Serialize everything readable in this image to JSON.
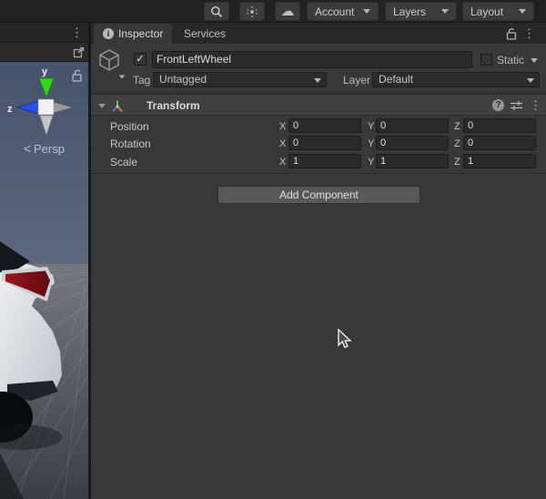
{
  "icons": {
    "cloud": "☁",
    "kebab": "⋮",
    "info": "i",
    "help": "?",
    "check": "✓"
  },
  "toolbar": {
    "account": "Account",
    "layers": "Layers",
    "layout": "Layout"
  },
  "scene": {
    "persp": "Persp",
    "persp_arrow": "<",
    "gizmo_y": "y",
    "gizmo_z": "z"
  },
  "inspector": {
    "tab_inspector": "Inspector",
    "tab_services": "Services",
    "gameobject": {
      "name": "FrontLeftWheel",
      "static_label": "Static",
      "tag_label": "Tag",
      "tag_value": "Untagged",
      "layer_label": "Layer",
      "layer_value": "Default"
    },
    "transform": {
      "title": "Transform",
      "axis_x": "X",
      "axis_y": "Y",
      "axis_z": "Z",
      "rows": [
        {
          "label": "Position",
          "x": "0",
          "y": "0",
          "z": "0"
        },
        {
          "label": "Rotation",
          "x": "0",
          "y": "0",
          "z": "0"
        },
        {
          "label": "Scale",
          "x": "1",
          "y": "1",
          "z": "1"
        }
      ]
    },
    "add_component": "Add Component"
  },
  "colors": {
    "panel": "#383838",
    "field": "#2a2a2a",
    "toolbar": "#222222",
    "gizmo_green": "#35d51c",
    "gizmo_blue": "#2b50e8",
    "taillight_red": "#8e1318"
  }
}
